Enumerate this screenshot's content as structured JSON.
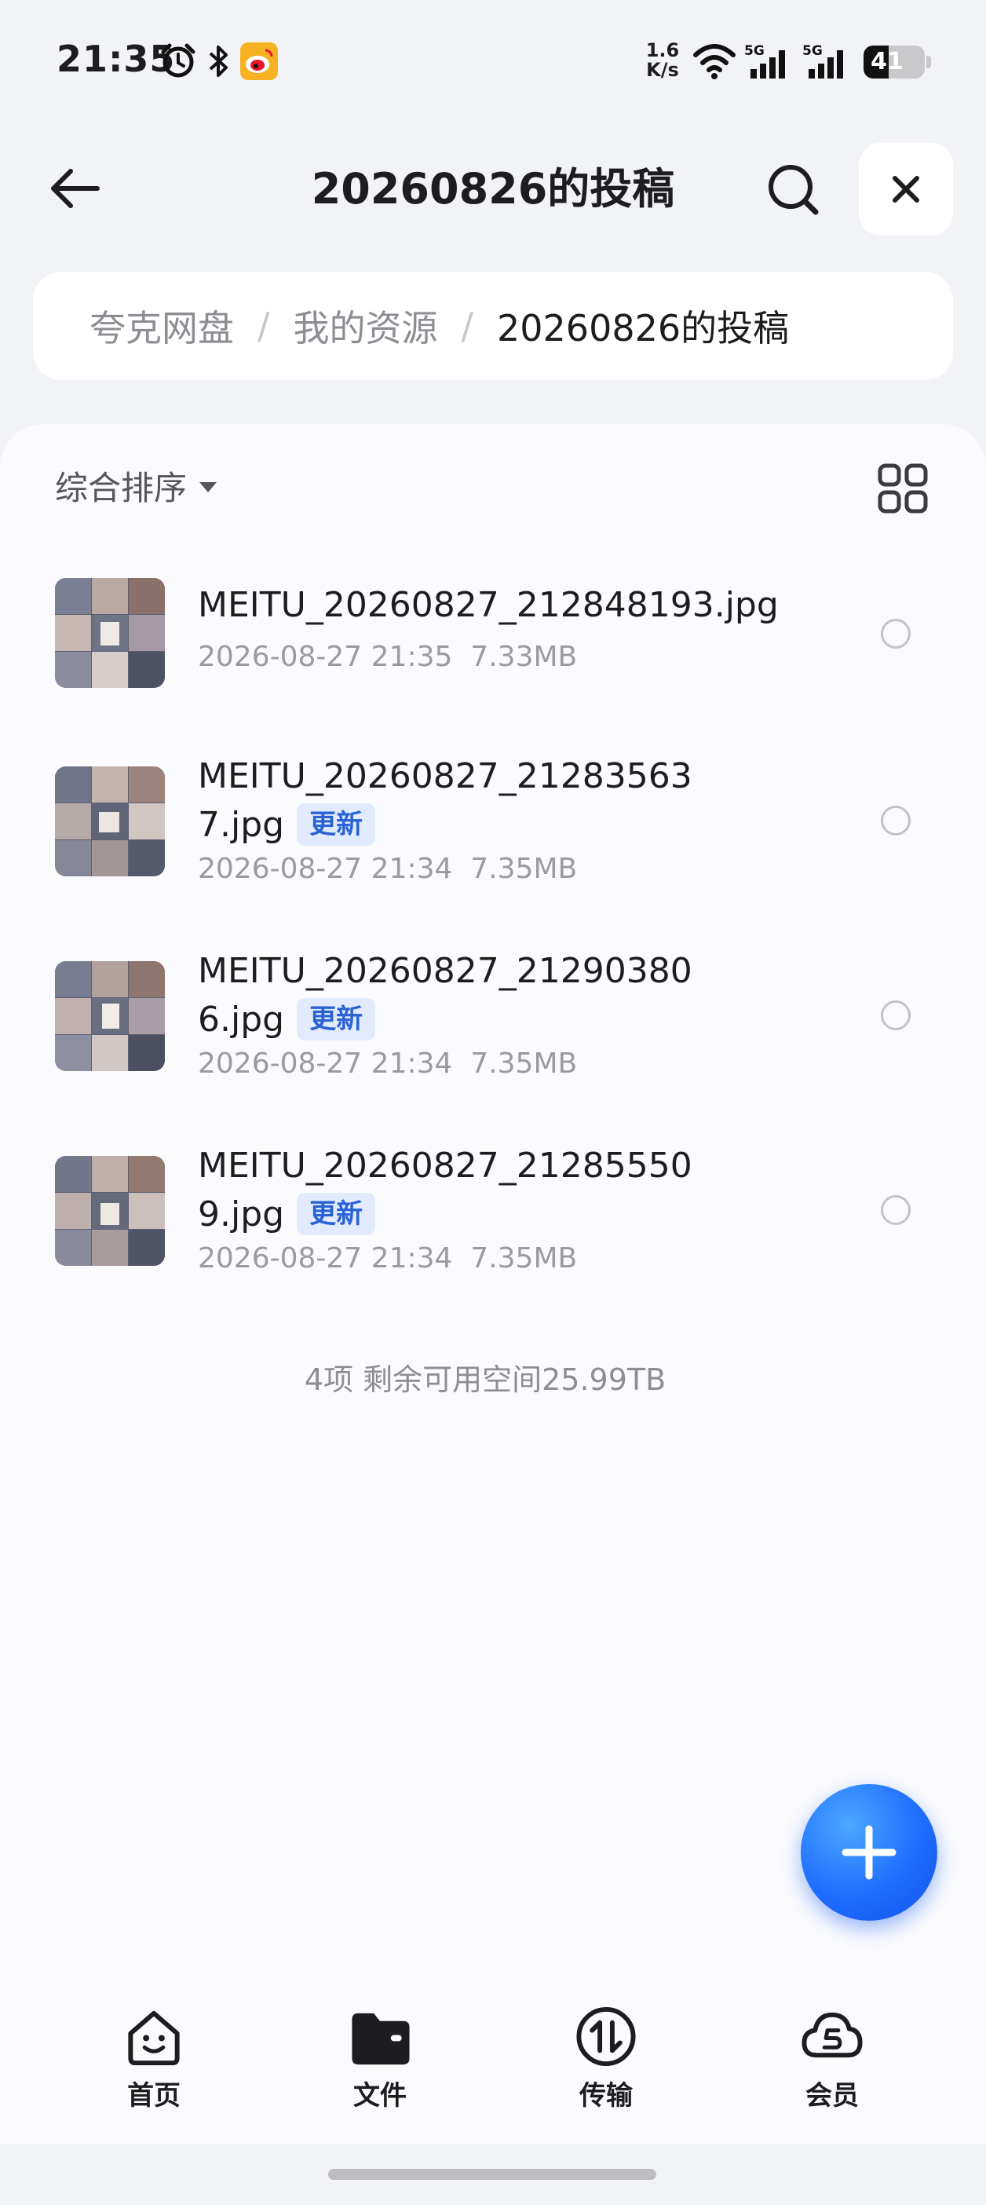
{
  "status_bar": {
    "time": "21:35",
    "network_speed_value": "1.6",
    "network_speed_unit": "K/s",
    "signal_1_label": "5G",
    "signal_2_label": "5G",
    "battery_level": "41",
    "battery_fraction": 0.41,
    "icons": [
      "alarm-icon",
      "bluetooth-icon",
      "weibo-icon",
      "wifi-icon",
      "signal-icon",
      "battery-icon"
    ]
  },
  "header": {
    "title": "20260826的投稿",
    "back_icon": "arrow-left-icon",
    "search_icon": "search-icon",
    "close_icon": "close-icon"
  },
  "breadcrumb": {
    "items": [
      "夸克网盘",
      "我的资源",
      "20260826的投稿"
    ],
    "separator": "/"
  },
  "toolbar": {
    "sort_label": "综合排序",
    "sort_icon": "caret-down-icon",
    "view_icon": "grid-view-icon"
  },
  "files": [
    {
      "name_line1": "MEITU_20260827_212848193.jpg",
      "name_line2": "",
      "badge": "",
      "date": "2026-08-27 21:35",
      "size": "7.33MB"
    },
    {
      "name_line1": "MEITU_20260827_21283563",
      "name_line2": "7.jpg",
      "badge": "更新",
      "date": "2026-08-27 21:34",
      "size": "7.35MB"
    },
    {
      "name_line1": "MEITU_20260827_21290380",
      "name_line2": "6.jpg",
      "badge": "更新",
      "date": "2026-08-27 21:34",
      "size": "7.35MB"
    },
    {
      "name_line1": "MEITU_20260827_21285550",
      "name_line2": "9.jpg",
      "badge": "更新",
      "date": "2026-08-27 21:34",
      "size": "7.35MB"
    }
  ],
  "summary": "4项 剩余可用空间25.99TB",
  "fab": {
    "icon": "plus-icon"
  },
  "bottom_nav": [
    {
      "label": "首页",
      "icon": "home-face-icon"
    },
    {
      "label": "文件",
      "icon": "folder-icon"
    },
    {
      "label": "传输",
      "icon": "transfer-icon"
    },
    {
      "label": "会员",
      "icon": "vip-cloud-icon"
    }
  ],
  "colors": {
    "accent": "#1f6dff",
    "badge_bg": "#e1ebfd",
    "badge_text": "#2a62d6",
    "background": "#f2f3f6"
  }
}
